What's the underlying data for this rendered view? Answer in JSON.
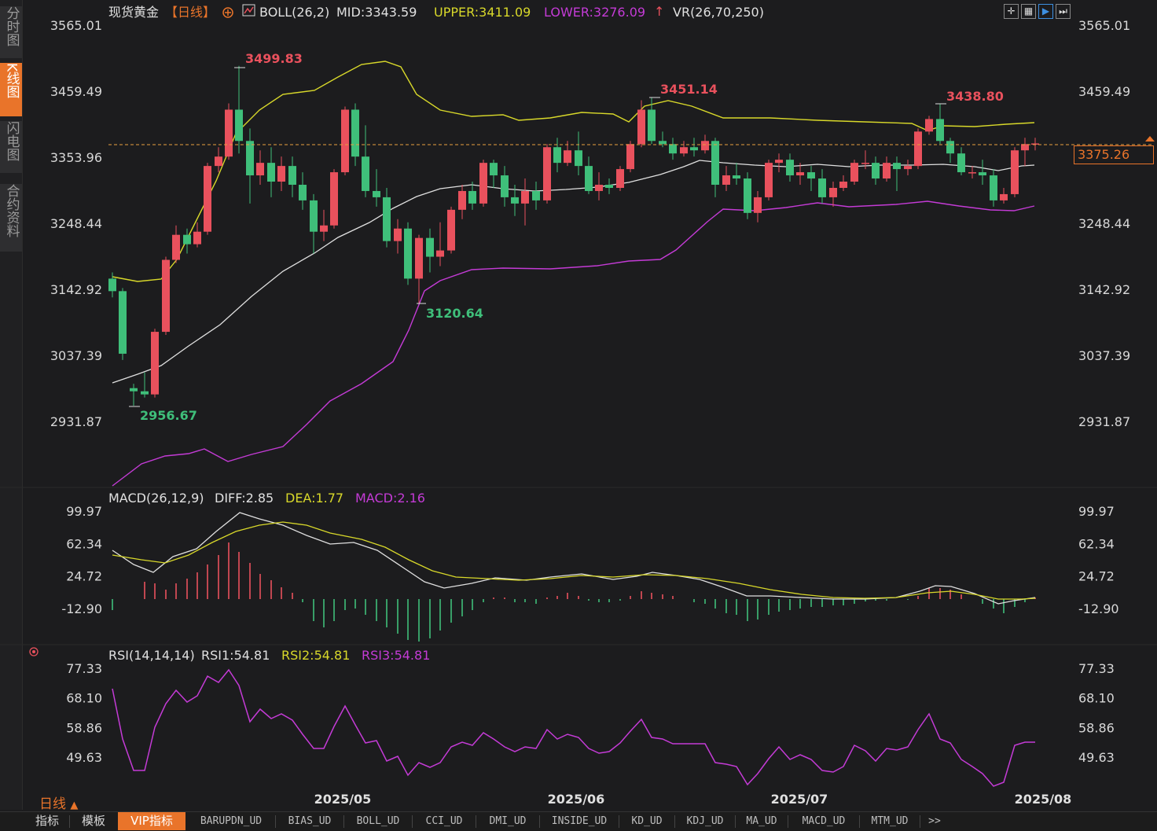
{
  "sidebar": {
    "tabs": [
      {
        "label": "分时图",
        "active": false
      },
      {
        "label": "K线图",
        "active": true
      },
      {
        "label": "闪电图",
        "active": false
      },
      {
        "label": "合约资料",
        "active": false
      }
    ]
  },
  "header": {
    "instrument": "现货黄金",
    "period_tag": "【日线】",
    "boll_label": "BOLL(26,2)",
    "mid": "MID:3343.59",
    "upper": "UPPER:3411.09",
    "lower": "LOWER:3276.09",
    "vr_label": "VR(26,70,250)"
  },
  "top_icons": [
    "grid-icon",
    "table-icon",
    "play-icon",
    "forward-icon"
  ],
  "price_axis": [
    "3565.01",
    "3459.49",
    "3353.96",
    "3248.44",
    "3142.92",
    "3037.39",
    "2931.87"
  ],
  "price_labels": {
    "high1": "3499.83",
    "high2": "3451.14",
    "high3": "3438.80",
    "low1": "2956.67",
    "low2": "3120.64",
    "current": "3375.26"
  },
  "macd": {
    "label": "MACD(26,12,9)",
    "diff": "DIFF:2.85",
    "dea": "DEA:1.77",
    "macd": "MACD:2.16",
    "axis": [
      "99.97",
      "62.34",
      "24.72",
      "-12.90"
    ]
  },
  "rsi": {
    "label": "RSI(14,14,14)",
    "rsi1": "RSI1:54.81",
    "rsi2": "RSI2:54.81",
    "rsi3": "RSI3:54.81",
    "axis": [
      "77.33",
      "68.10",
      "58.86",
      "49.63"
    ]
  },
  "date_axis": [
    "2025/05",
    "2025/06",
    "2025/07",
    "2025/08"
  ],
  "period_label": "日线",
  "bottom_bar": {
    "indicator": "指标",
    "template": "模板",
    "vip": "VIP指标",
    "items": [
      "BARUPDN_UD",
      "BIAS_UD",
      "BOLL_UD",
      "CCI_UD",
      "DMI_UD",
      "INSIDE_UD",
      "KD_UD",
      "KDJ_UD",
      "MA_UD",
      "MACD_UD",
      "MTM_UD",
      ">>"
    ]
  },
  "colors": {
    "up": "#e9515d",
    "down": "#3fbf7a",
    "upper_band": "#d8d82a",
    "lower_band": "#c43bd6",
    "mid_band": "#e0e0e0",
    "accent": "#e9742a"
  },
  "chart_data": [
    {
      "type": "candlestick",
      "title": "现货黄金",
      "x": [
        "2025/05",
        "2025/06",
        "2025/07",
        "2025/08"
      ],
      "ylim": [
        2931.87,
        3565.01
      ],
      "annotations": {
        "max": 3499.83,
        "min": 2956.67,
        "local_high_1": 3451.14,
        "local_high_2": 3438.8,
        "local_low": 3120.64,
        "last": 3375.26
      },
      "series": [
        {
          "name": "MID",
          "last": 3343.59
        },
        {
          "name": "UPPER",
          "last": 3411.09
        },
        {
          "name": "LOWER",
          "last": 3276.09
        }
      ]
    },
    {
      "type": "line",
      "title": "MACD(26,12,9)",
      "ylim": [
        -12.9,
        99.97
      ],
      "series": [
        {
          "name": "DIFF",
          "last": 2.85
        },
        {
          "name": "DEA",
          "last": 1.77
        },
        {
          "name": "MACD",
          "last": 2.16
        }
      ]
    },
    {
      "type": "line",
      "title": "RSI(14,14,14)",
      "ylim": [
        49.63,
        77.33
      ],
      "series": [
        {
          "name": "RSI1",
          "last": 54.81
        },
        {
          "name": "RSI2",
          "last": 54.81
        },
        {
          "name": "RSI3",
          "last": 54.81
        }
      ]
    }
  ]
}
